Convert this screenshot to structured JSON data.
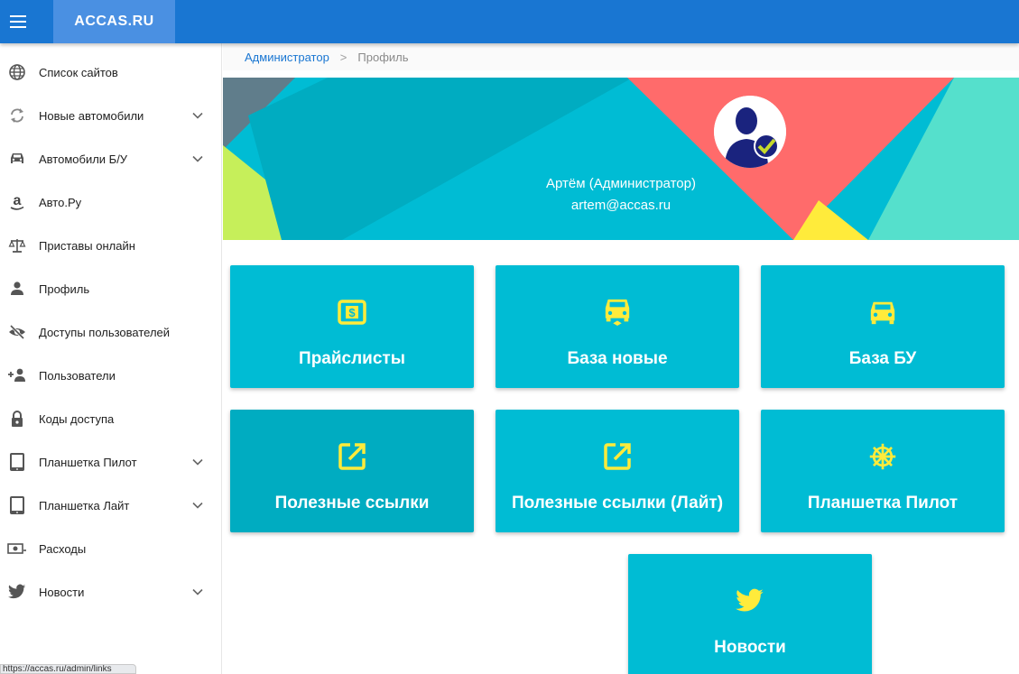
{
  "app": {
    "brand": "ACCAS.RU"
  },
  "sidebar": {
    "items": [
      {
        "label": "Список сайтов",
        "icon": "globe-icon"
      },
      {
        "label": "Новые автомобили",
        "icon": "sync-icon",
        "expandable": true
      },
      {
        "label": "Автомобили Б/У",
        "icon": "car-icon",
        "expandable": true
      },
      {
        "label": "Авто.Ру",
        "icon": "amazon-icon"
      },
      {
        "label": "Приставы онлайн",
        "icon": "balance-scale-icon"
      },
      {
        "label": "Профиль",
        "icon": "person-icon"
      },
      {
        "label": "Доступы пользователей",
        "icon": "eye-off-icon"
      },
      {
        "label": "Пользователи",
        "icon": "person-add-icon"
      },
      {
        "label": "Коды доступа",
        "icon": "lock-icon"
      },
      {
        "label": "Планшетка Пилот",
        "icon": "tablet-icon",
        "expandable": true
      },
      {
        "label": "Планшетка Лайт",
        "icon": "tablet-icon",
        "expandable": true
      },
      {
        "label": "Расходы",
        "icon": "money-icon"
      },
      {
        "label": "Новости",
        "icon": "twitter-icon",
        "expandable": true
      }
    ]
  },
  "status_bar": {
    "url": "https://accas.ru/admin/links"
  },
  "breadcrumb": {
    "parent": "Администратор",
    "separator": ">",
    "current": "Профиль"
  },
  "profile": {
    "name": "Артём (Администратор)",
    "email": "artem@accas.ru"
  },
  "tiles": [
    {
      "label": "Прайслисты",
      "icon": "dollar-box-icon"
    },
    {
      "label": "База новые",
      "icon": "car-sync-icon"
    },
    {
      "label": "База БУ",
      "icon": "car-icon"
    },
    {
      "label": "Полезные ссылки",
      "icon": "open-external-icon"
    },
    {
      "label": "Полезные ссылки (Лайт)",
      "icon": "open-external-icon"
    },
    {
      "label": "Планшетка Пилот",
      "icon": "ship-wheel-icon"
    },
    {
      "label": "Новости",
      "icon": "twitter-icon"
    }
  ],
  "colors": {
    "appbar": "#1976d2",
    "brand_bg": "#4a90e2",
    "tile": "#00bcd4",
    "tile_hover": "#00acc1",
    "tile_icon": "#ffeb3b",
    "link": "#1976d2"
  }
}
